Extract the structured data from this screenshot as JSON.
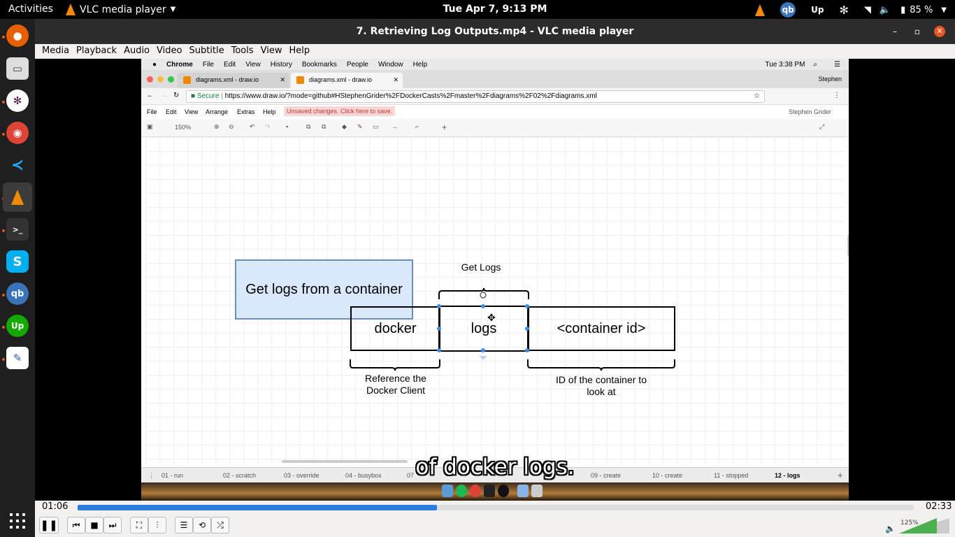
{
  "topbar": {
    "activities": "Activities",
    "app_name": "VLC media player",
    "clock": "Tue Apr  7,  9:13 PM",
    "battery": "85 %"
  },
  "window": {
    "title": "7. Retrieving Log Outputs.mp4 - VLC media player",
    "menu": [
      "Media",
      "Playback",
      "Audio",
      "Video",
      "Subtitle",
      "Tools",
      "View",
      "Help"
    ]
  },
  "video": {
    "mac_menubar": {
      "app": "Chrome",
      "items": [
        "File",
        "Edit",
        "View",
        "History",
        "Bookmarks",
        "People",
        "Window",
        "Help"
      ],
      "clock": "Tue 3:38 PM",
      "user": "Stephen"
    },
    "browser": {
      "tabs": [
        "diagrams.xml - draw.io",
        "diagrams.xml - draw.io"
      ],
      "secure": "Secure",
      "url": "https://www.draw.io/?mode=github#HStephenGrider%2FDockerCasts%2Fmaster%2Fdiagrams%2F02%2Fdiagrams.xml"
    },
    "drawio": {
      "menu": [
        "File",
        "Edit",
        "View",
        "Arrange",
        "Extras",
        "Help"
      ],
      "unsaved": "Unsaved changes. Click here to save.",
      "user": "Stephen Grider",
      "zoom": "150%",
      "title_box": "Get logs from a container",
      "get_logs": "Get Logs",
      "cmd_docker": "docker",
      "cmd_logs": "logs",
      "cmd_container": "<container id>",
      "ref_label_1": "Reference the",
      "ref_label_2": "Docker Client",
      "id_label_1": "ID of the container to",
      "id_label_2": "look at",
      "pages": [
        "01 - run",
        "02 - scratch",
        "03 - override",
        "04 - busybox",
        "07",
        "09 - create",
        "10 - create",
        "11 - stopped",
        "12 - logs"
      ]
    },
    "subtitle": "of docker logs."
  },
  "controls": {
    "elapsed": "01:06",
    "total": "02:33",
    "progress": 0.43,
    "volume": "125%",
    "volume_level": 1.25
  }
}
